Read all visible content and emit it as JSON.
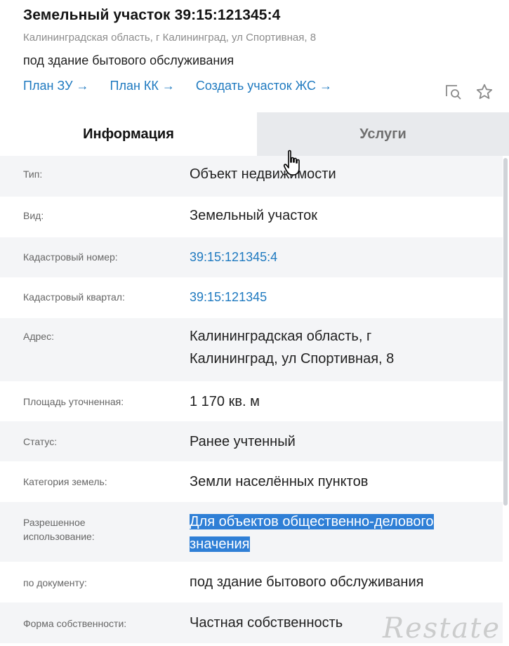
{
  "header": {
    "title": "Земельный участок 39:15:121345:4",
    "address": "Калининградская область, г Калининград, ул Спортивная, 8",
    "purpose": "под здание бытового обслуживания",
    "links": [
      {
        "label": "План ЗУ →"
      },
      {
        "label": "План КК →"
      },
      {
        "label": "Создать участок ЖС →"
      }
    ],
    "icons": [
      "zoom-search-icon",
      "star-icon"
    ]
  },
  "tabs": [
    {
      "label": "Информация",
      "active": true
    },
    {
      "label": "Услуги",
      "active": false
    }
  ],
  "rows": [
    {
      "label": "Тип:",
      "value": "Объект недвижимости"
    },
    {
      "label": "Вид:",
      "value": "Земельный участок"
    },
    {
      "label": "Кадастровый номер:",
      "value": "39:15:121345:4"
    },
    {
      "label": "Кадастровый квартал:",
      "value": "39:15:121345"
    },
    {
      "label": "Адрес:",
      "value": "Калининградская область, г Калининград, ул Спортивная, 8"
    },
    {
      "label": "Площадь уточненная:",
      "value": "1 170 кв. м"
    },
    {
      "label": "Статус:",
      "value": "Ранее учтенный"
    },
    {
      "label": "Категория земель:",
      "value": "Земли населённых пунктов"
    },
    {
      "label": "Разрешенное использование:",
      "value": "Для объектов общественно-делового значения"
    },
    {
      "label": "по документу:",
      "value": "под здание бытового обслуживания"
    },
    {
      "label": "Форма собственности:",
      "value": "Частная собственность"
    }
  ],
  "watermark": "Restate",
  "colors": {
    "link": "#1f7ac0",
    "selection": "#2f7fd6",
    "tab_inactive_bg": "#e8eaed",
    "row_alt_bg": "#f4f5f7"
  }
}
